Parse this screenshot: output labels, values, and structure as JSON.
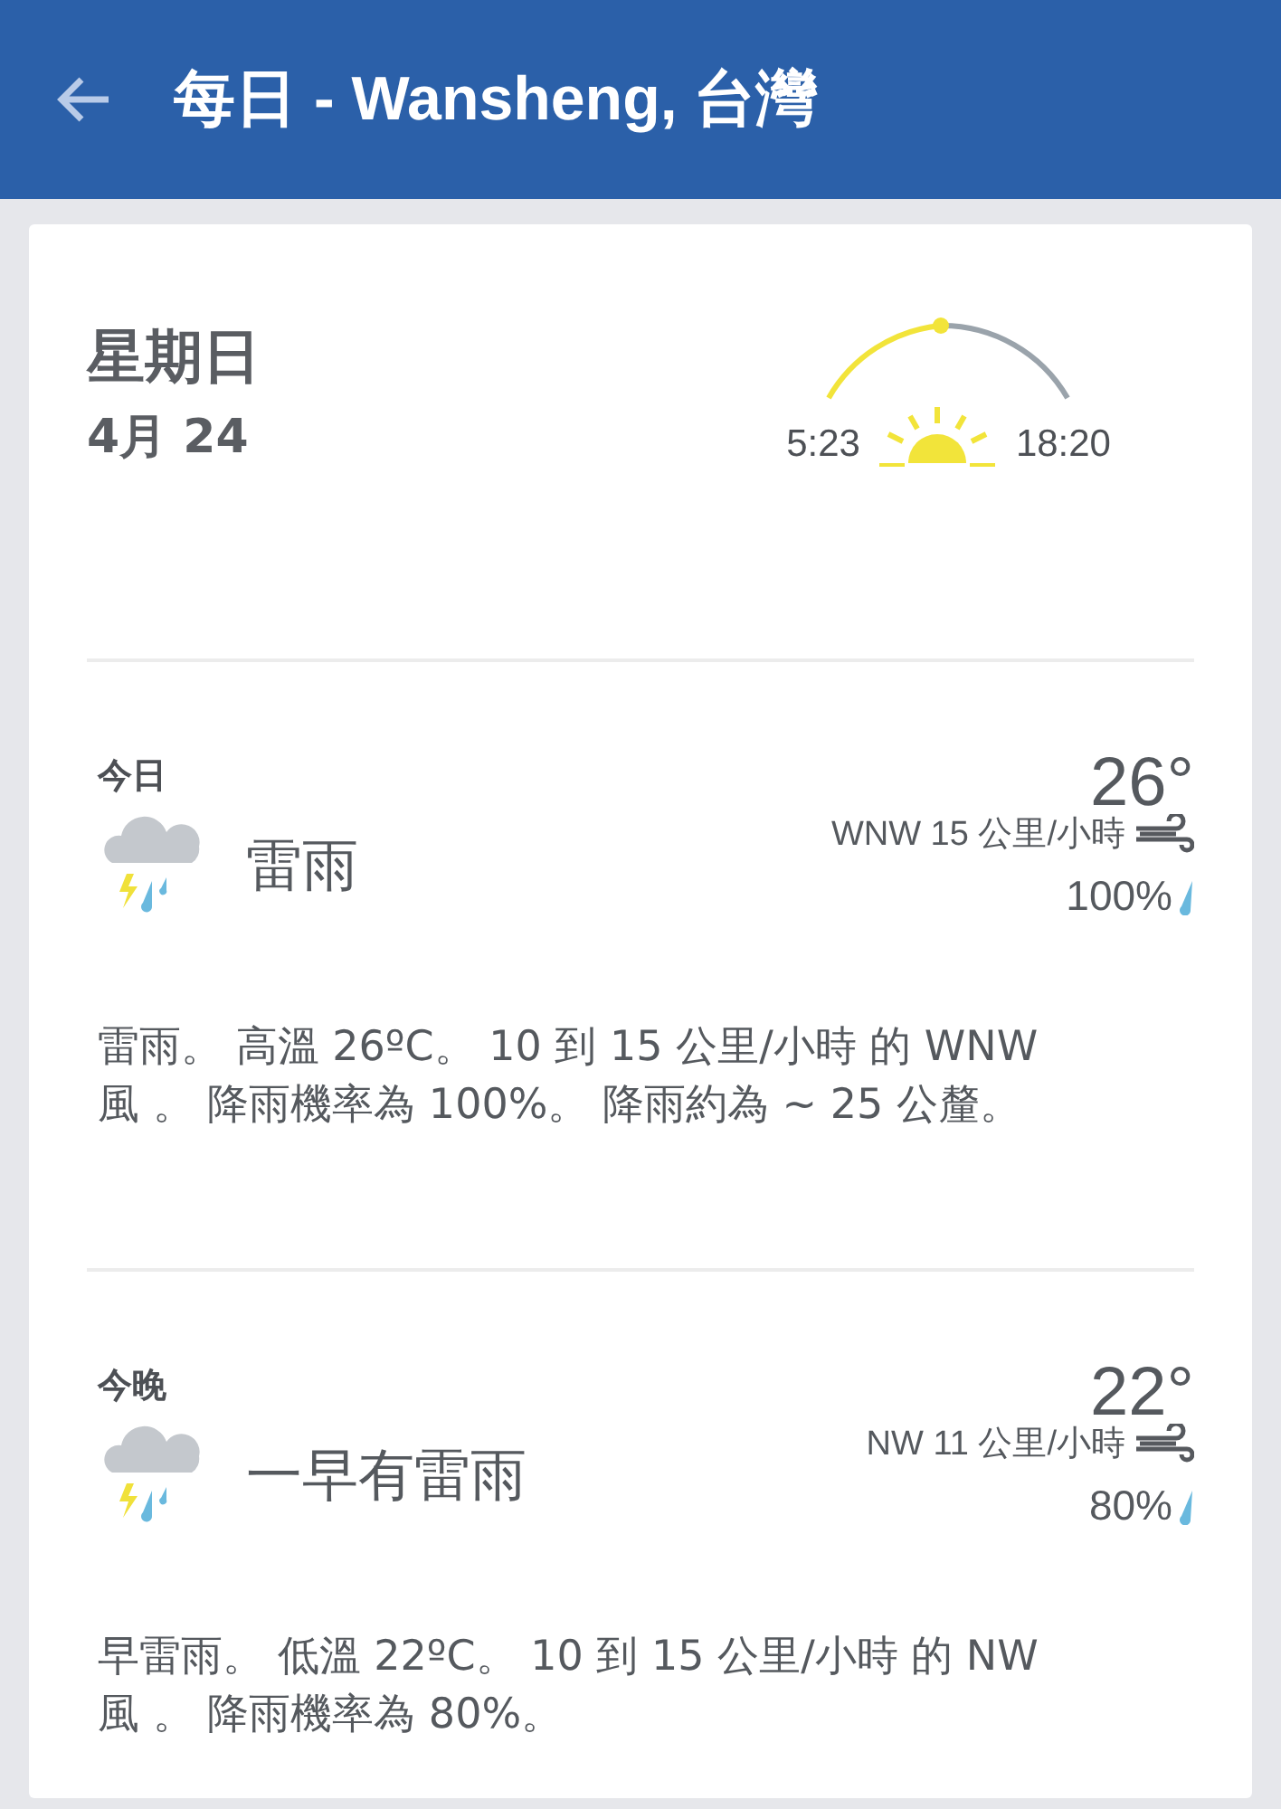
{
  "app_bar": {
    "title": "每日 - Wansheng, 台灣"
  },
  "day": {
    "weekday": "星期日",
    "date": "4月 24",
    "sunrise": "5:23",
    "sunset": "18:20"
  },
  "periods": [
    {
      "label": "今日",
      "condition": "雷雨",
      "temperature": "26°",
      "wind": "WNW 15 公里/小時",
      "precipitation": "100%",
      "summary": "雷雨。 高溫 26ºC。 10 到 15 公里/小時 的 WNW 風 。 降雨機率為 100%。 降雨約為 ~ 25 公釐。"
    },
    {
      "label": "今晚",
      "condition": "一早有雷雨",
      "temperature": "22°",
      "wind": "NW 11 公里/小時",
      "precipitation": "80%",
      "summary": "早雷雨。 低溫 22ºC。 10 到 15 公里/小時 的 NW 風 。 降雨機率為 80%。"
    }
  ]
}
